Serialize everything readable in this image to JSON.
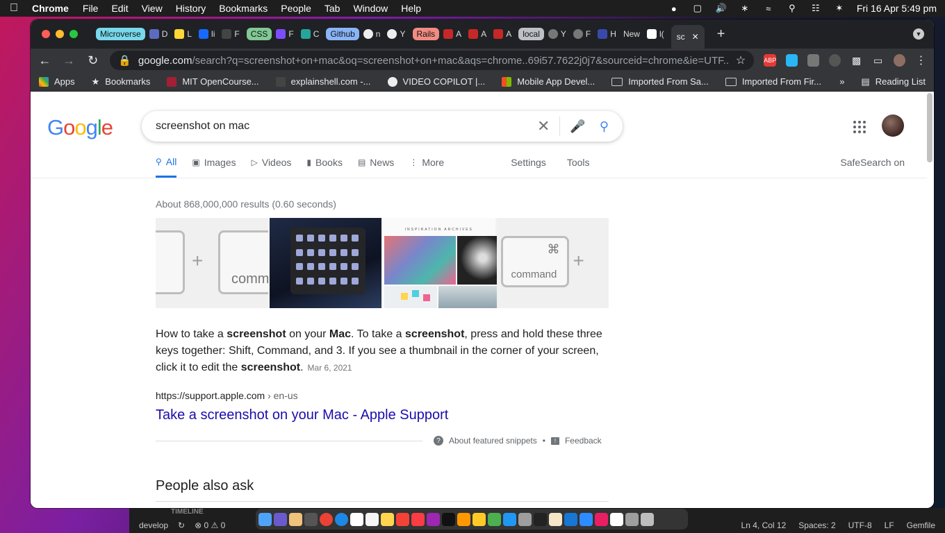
{
  "menubar": {
    "app": "Chrome",
    "items": [
      "File",
      "Edit",
      "View",
      "History",
      "Bookmarks",
      "People",
      "Tab",
      "Window",
      "Help"
    ],
    "datetime": "Fri 16 Apr  5:49 pm"
  },
  "tabs": {
    "group1": "Microverse",
    "group2": "CSS",
    "group3": "Github",
    "group4": "Rails",
    "group5": "local",
    "mini1": "D",
    "mini2": "L",
    "mini3": "li",
    "mini4": "F",
    "mini5": "F",
    "mini6": "C",
    "mini7": "n",
    "mini8": "Y",
    "mini9": "A",
    "mini10": "A",
    "mini11": "A",
    "mini12": "Y",
    "mini13": "F",
    "mini14": "H",
    "mini15": "New",
    "mini16": "l(",
    "active": "sc"
  },
  "omnibox": {
    "host": "google.com",
    "path": "/search?q=screenshot+on+mac&oq=screenshot+on+mac&aqs=chrome..69i57.7622j0j7&sourceid=chrome&ie=UTF..."
  },
  "bookmarks": {
    "apps": "Apps",
    "bookmarks": "Bookmarks",
    "mit": "MIT OpenCourse...",
    "explainshell": "explainshell.com -...",
    "video": "VIDEO COPILOT |...",
    "mobile": "Mobile App Devel...",
    "imported_sa": "Imported From Sa...",
    "imported_fir": "Imported From Fir...",
    "reading": "Reading List"
  },
  "search": {
    "query": "screenshot on mac",
    "tabs": [
      "All",
      "Images",
      "Videos",
      "Books",
      "News",
      "More"
    ],
    "settings": "Settings",
    "tools": "Tools",
    "safesearch": "SafeSearch on",
    "stats": "About 868,000,000 results (0.60 seconds)"
  },
  "images": {
    "key_label1": "comma",
    "key_label2": "command",
    "art_title": "INSPIRATION ARCHIVES"
  },
  "snippet": {
    "p1": "How to take a ",
    "b1": "screenshot",
    "p2": " on your ",
    "b2": "Mac",
    "p3": ". To take a ",
    "b3": "screenshot",
    "p4": ", press and hold these three keys together: Shift, Command, and 3. If you see a thumbnail in the corner of your screen, click it to edit the ",
    "b4": "screenshot",
    "p5": ".",
    "date": "Mar 6, 2021",
    "cite_url": "https://support.apple.com",
    "cite_crumb": " › en-us",
    "title": "Take a screenshot on your Mac - Apple Support",
    "about": "About featured snippets",
    "feedback": "Feedback"
  },
  "paa": {
    "title": "People also ask"
  },
  "vscode": {
    "timeline": "TIMELINE",
    "branch": "develop",
    "problems": "⊗ 0 ⚠ 0",
    "position": "Ln 4, Col 12",
    "spaces": "Spaces: 2",
    "encoding": "UTF-8",
    "eol": "LF",
    "lang": "Gemfile"
  }
}
